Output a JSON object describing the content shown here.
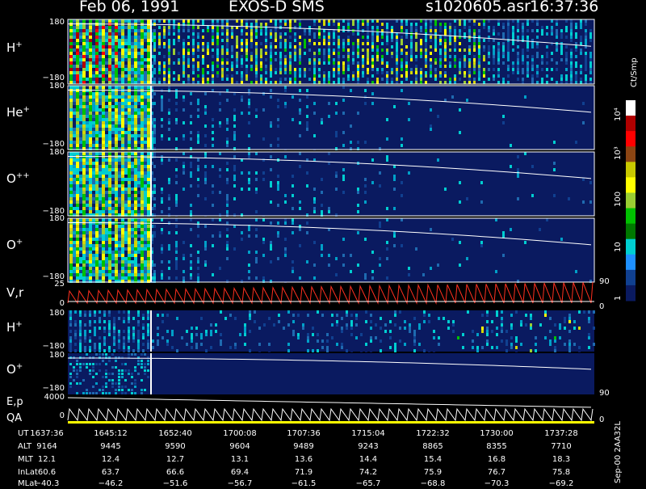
{
  "header": {
    "date": "Feb 06, 1991",
    "instrument": "EXOS-D SMS",
    "file": "s1020605.asr",
    "time": "16:37:36"
  },
  "colorbar": {
    "unit": "Ct/Smp",
    "ticks": [
      "10⁴",
      "10³",
      "100",
      "10",
      "1"
    ],
    "colors": [
      "#ffffff",
      "#b00000",
      "#ff0000",
      "#8b4513",
      "#c8c800",
      "#ffff00",
      "#9acd32",
      "#00c000",
      "#007800",
      "#00ced1",
      "#1e90ff",
      "#104090",
      "#0a1a60"
    ]
  },
  "panels": [
    {
      "id": "h-plus",
      "species": "H",
      "charge": "+",
      "top_tick": "180",
      "bottom_tick": "−180",
      "intensity": "high"
    },
    {
      "id": "he-plus",
      "species": "He",
      "charge": "+",
      "top_tick": "180",
      "bottom_tick": "−180",
      "intensity": "mid"
    },
    {
      "id": "o-plus-plus",
      "species": "O",
      "charge": "++",
      "top_tick": "180",
      "bottom_tick": "−180",
      "intensity": "mid"
    },
    {
      "id": "o-plus",
      "species": "O",
      "charge": "+",
      "top_tick": "180",
      "bottom_tick": "−180",
      "intensity": "mid"
    }
  ],
  "vr_panel": {
    "label": "V,r",
    "ticks": [
      "25",
      "0"
    ],
    "right_ticks": [
      "90",
      "0"
    ]
  },
  "lower_panels": [
    {
      "id": "h-plus-2",
      "species": "H",
      "charge": "+",
      "top_tick": "180",
      "bottom_tick": "−180"
    },
    {
      "id": "o-plus-2",
      "species": "O",
      "charge": "+",
      "top_tick": "180",
      "bottom_tick": "−180"
    }
  ],
  "ep_panel": {
    "label_top": "E,p",
    "label_bottom": "QA",
    "ticks": [
      "4000",
      "0"
    ],
    "right_ticks": [
      "90",
      "0"
    ]
  },
  "ephemeris": {
    "UT": [
      "1637:36",
      "1645:12",
      "1652:40",
      "1700:08",
      "1707:36",
      "1715:04",
      "1722:32",
      "1730:00",
      "1737:28"
    ],
    "ALT": [
      "9164",
      "9445",
      "9590",
      "9604",
      "9489",
      "9243",
      "8865",
      "8355",
      "7710"
    ],
    "MLT": [
      "12.1",
      "12.4",
      "12.7",
      "13.1",
      "13.6",
      "14.4",
      "15.4",
      "16.8",
      "18.3"
    ],
    "InLat": [
      "60.6",
      "63.7",
      "66.6",
      "69.4",
      "71.9",
      "74.2",
      "75.9",
      "76.7",
      "75.8"
    ],
    "MLat": [
      "−40.3",
      "−46.2",
      "−51.6",
      "−56.7",
      "−61.5",
      "−65.7",
      "−68.8",
      "−70.3",
      "−69.2"
    ]
  },
  "footer_text": "Sep-00  2AA32L",
  "chart_data": {
    "type": "heatmap",
    "title": "Feb 06, 1991   EXOS-D SMS   s1020605.asr  16:37:36",
    "x": [
      "1637:36",
      "1645:12",
      "1652:40",
      "1700:08",
      "1707:36",
      "1715:04",
      "1722:32",
      "1730:00",
      "1737:28"
    ],
    "xlabel": "UT",
    "ylim": [
      -180,
      180
    ],
    "series": [
      {
        "name": "H+"
      },
      {
        "name": "He+"
      },
      {
        "name": "O++"
      },
      {
        "name": "O+"
      },
      {
        "name": "V,r"
      },
      {
        "name": "H+"
      },
      {
        "name": "O+"
      },
      {
        "name": "E,p"
      }
    ],
    "color_scale": "log",
    "color_range": [
      1,
      10000
    ]
  }
}
